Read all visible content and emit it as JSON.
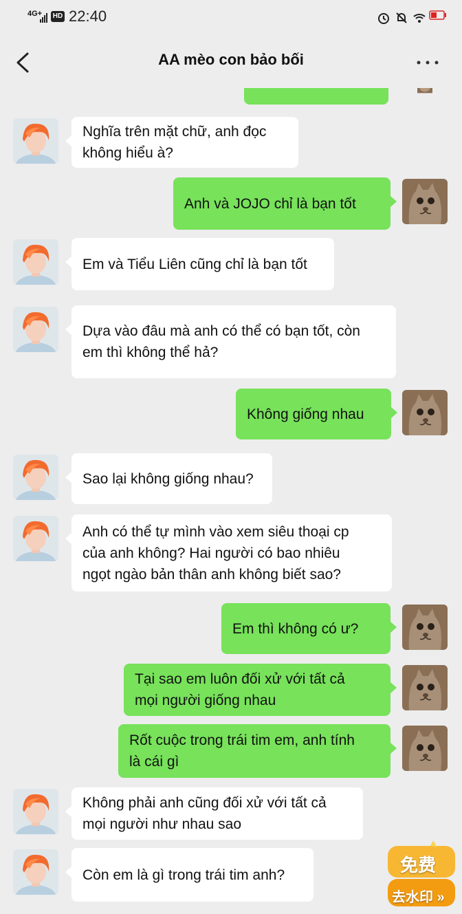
{
  "status_bar": {
    "network": "4G+",
    "hd": "HD",
    "time": "22:40"
  },
  "header": {
    "title": "AA mèo con bảo bối"
  },
  "messages": [
    {
      "side": "in",
      "text": "Nghĩa trên mặt chữ, anh đọc\nkhông hiểu à?"
    },
    {
      "side": "out",
      "text": "Anh và JOJO chỉ là bạn tốt"
    },
    {
      "side": "in",
      "text": "Em và Tiểu Liên cũng chỉ là bạn tốt"
    },
    {
      "side": "in",
      "text": "Dựa vào đâu mà anh có thể có bạn tốt, còn\nem thì không thể hả?"
    },
    {
      "side": "out",
      "text": "Không giống nhau"
    },
    {
      "side": "in",
      "text": "Sao lại không giống nhau?"
    },
    {
      "side": "in",
      "text": "Anh có thể tự mình vào xem siêu thoại cp\ncủa anh không? Hai người có bao nhiêu\nngọt ngào bản thân anh không biết sao?"
    },
    {
      "side": "out",
      "text": "Em thì không có ư?"
    },
    {
      "side": "out",
      "text": "Tại sao em luôn đối xử với tất cả\nmọi người giống nhau"
    },
    {
      "side": "out",
      "text": "Rốt cuộc trong trái tim em, anh tính\nlà cái gì"
    },
    {
      "side": "in",
      "text": "Không phải anh cũng đối xử với tất cả\nmọi người như nhau sao"
    },
    {
      "side": "in",
      "text": "Còn em là gì trong trái tim anh?"
    }
  ],
  "watermark_badge": {
    "top_text": "免费",
    "bottom_text": "去水印 »"
  },
  "colors": {
    "background": "#ededed",
    "incoming_bubble": "#ffffff",
    "outgoing_bubble": "#77e25a",
    "badge": "#f5a623"
  }
}
